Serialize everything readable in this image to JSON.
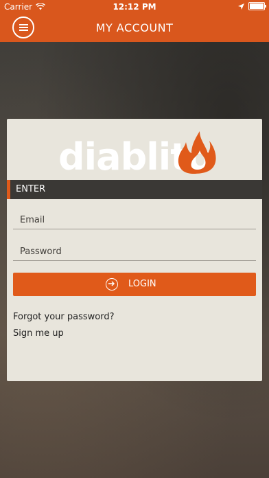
{
  "status_bar": {
    "carrier": "Carrier",
    "time": "12:12 PM"
  },
  "nav": {
    "title": "MY ACCOUNT"
  },
  "logo": {
    "text": "diablito"
  },
  "section": {
    "label": "ENTER"
  },
  "form": {
    "email_placeholder": "Email",
    "password_placeholder": "Password",
    "login_label": "LOGIN"
  },
  "links": {
    "forgot": "Forgot your password?",
    "signup": "Sign me up"
  },
  "colors": {
    "brand": "#d9571d",
    "accent": "#e05a1a",
    "card": "#e8e5dc",
    "section_bar": "#3a3835"
  }
}
